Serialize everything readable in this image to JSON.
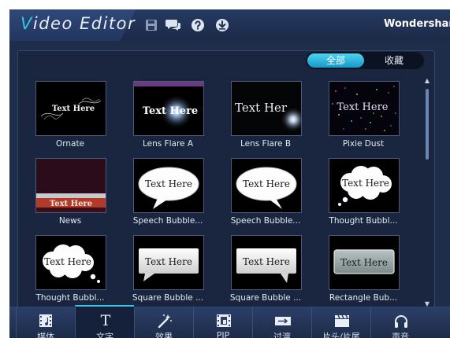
{
  "app": {
    "title_first": "V",
    "title_rest": "ideo Editor",
    "brand": "Wondershare"
  },
  "toolbar_icons": [
    "save-icon",
    "chat-icon",
    "help-icon",
    "download-icon"
  ],
  "filter": {
    "all": "全部",
    "favorites": "收藏",
    "selected": "all"
  },
  "templates": [
    {
      "name": "Ornate",
      "preview_text": "Text Here"
    },
    {
      "name": "Lens Flare A",
      "preview_text": "Text Here"
    },
    {
      "name": "Lens Flare B",
      "preview_text": "Text Her"
    },
    {
      "name": "Pixie Dust",
      "preview_text": "Text Here"
    },
    {
      "name": "News",
      "preview_text": "Text Here"
    },
    {
      "name": "Speech Bubble...",
      "preview_text": "Text Here"
    },
    {
      "name": "Speech Bubble...",
      "preview_text": "Text Here"
    },
    {
      "name": "Thought Bubbl...",
      "preview_text": "Text Here"
    },
    {
      "name": "Thought Bubbl...",
      "preview_text": "Text Here"
    },
    {
      "name": "Square Bubble ...",
      "preview_text": "Text Here"
    },
    {
      "name": "Square Bubble ...",
      "preview_text": "Text Here"
    },
    {
      "name": "Rectangle Bub...",
      "preview_text": "Text Here"
    }
  ],
  "bottom_tabs": [
    {
      "label": "媒体",
      "icon": "film-music-icon"
    },
    {
      "label": "文字",
      "icon": "text-t-icon",
      "active": true
    },
    {
      "label": "效果",
      "icon": "magic-wand-icon"
    },
    {
      "label": "PIP",
      "icon": "pip-film-icon"
    },
    {
      "label": "过渡",
      "icon": "transition-icon"
    },
    {
      "label": "片头/片尾",
      "icon": "clapperboard-icon"
    },
    {
      "label": "声音",
      "icon": "headphones-icon"
    }
  ],
  "colors": {
    "accent": "#3cc3ea",
    "window_bg": "#1e2d4a",
    "panel_bg": "#1a2640"
  }
}
